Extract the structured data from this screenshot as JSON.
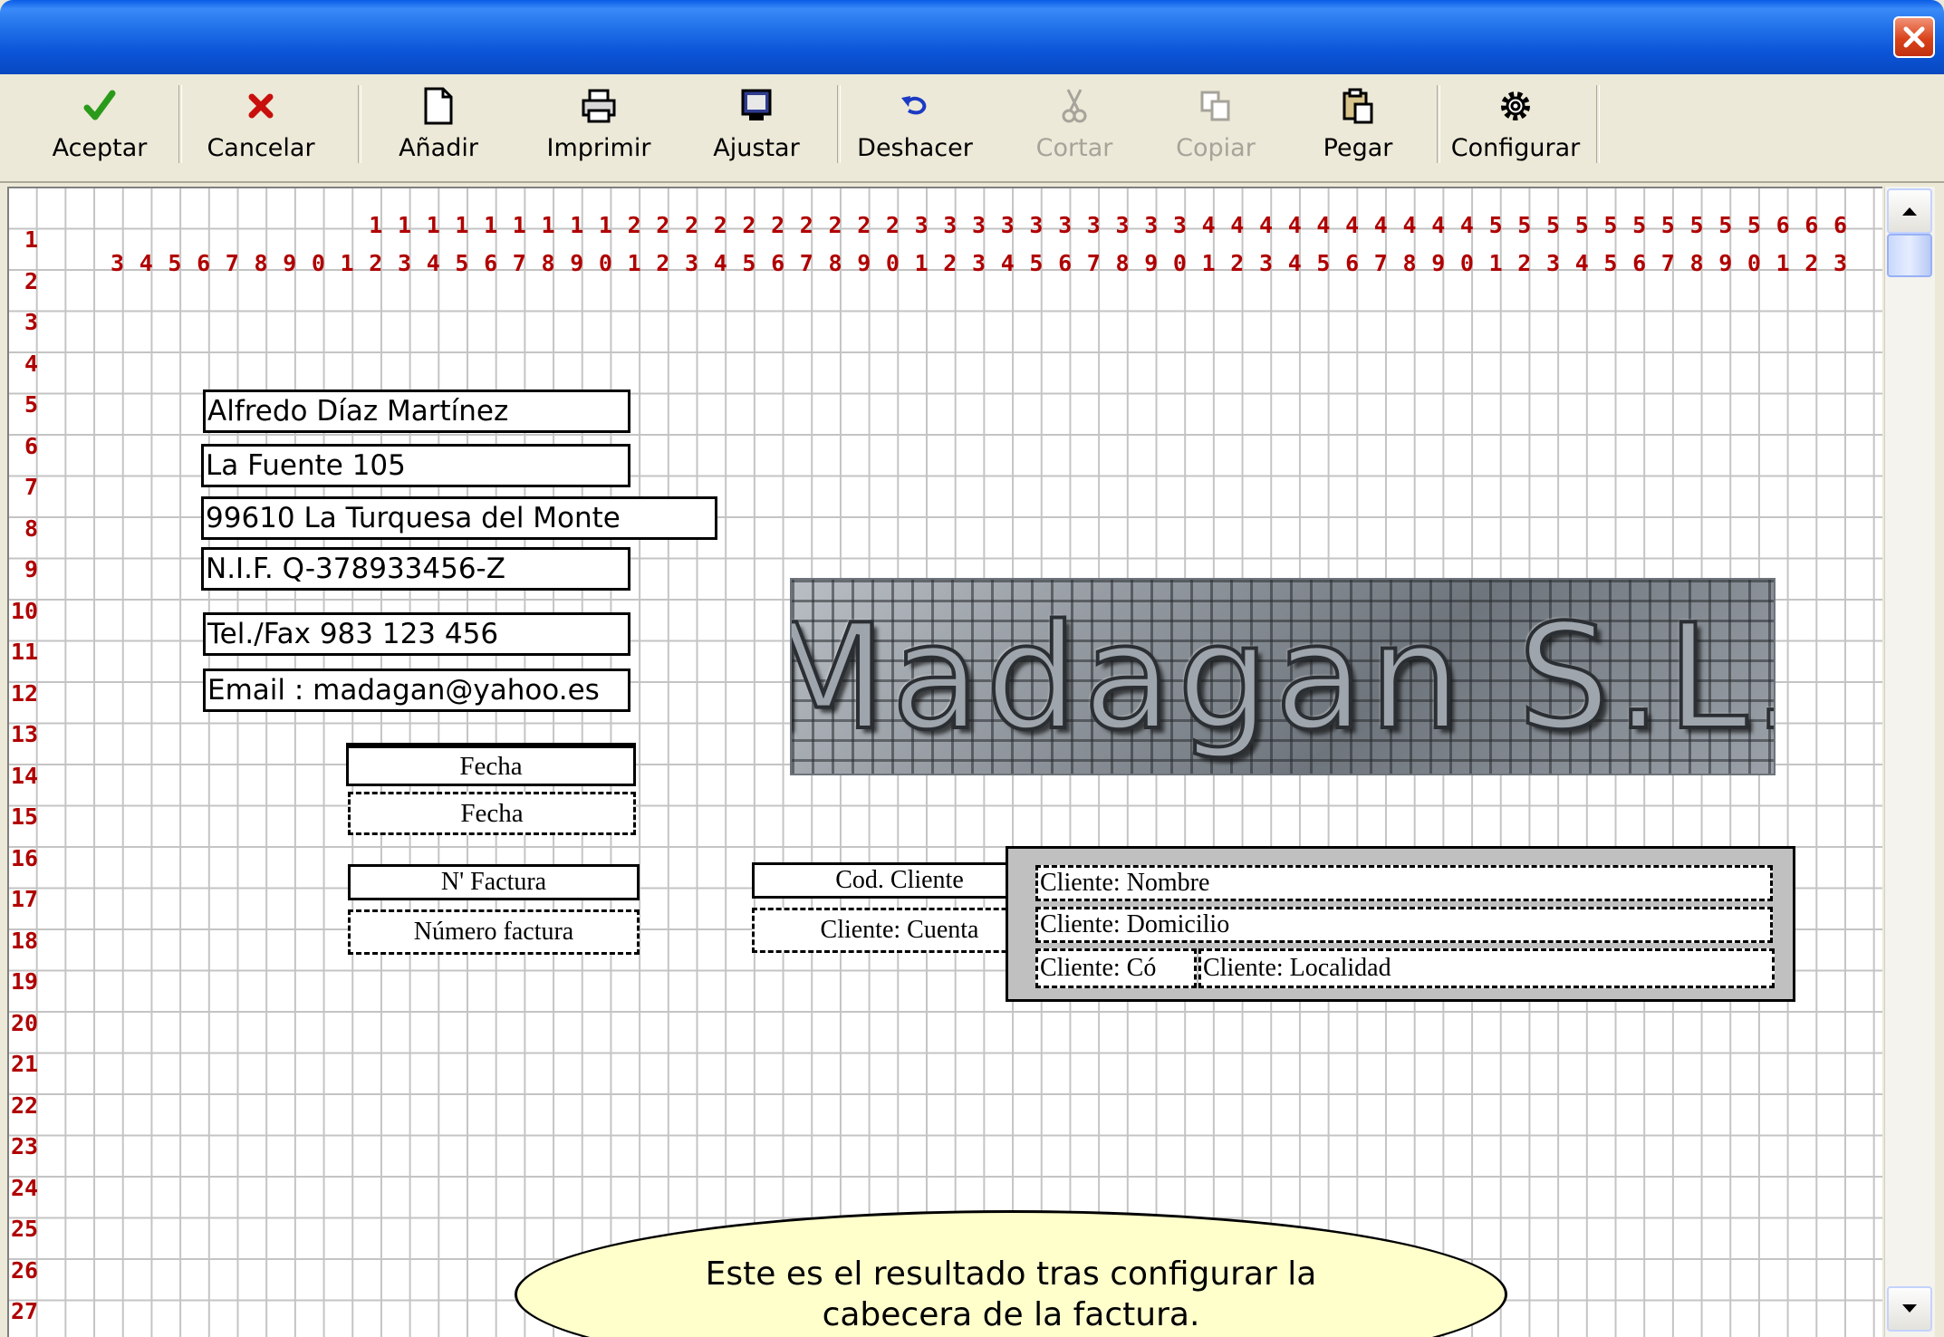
{
  "window": {
    "title": "",
    "close_icon": "close-icon"
  },
  "toolbar": {
    "items": [
      {
        "label": "Aceptar",
        "icon": "checkmark-icon",
        "enabled": true
      },
      {
        "label": "Cancelar",
        "icon": "x-icon",
        "enabled": true
      },
      {
        "label": "Añadir",
        "icon": "new-page-icon",
        "enabled": true
      },
      {
        "label": "Imprimir",
        "icon": "printer-icon",
        "enabled": true
      },
      {
        "label": "Ajustar",
        "icon": "monitor-icon",
        "enabled": true
      },
      {
        "label": "Deshacer",
        "icon": "undo-icon",
        "enabled": true
      },
      {
        "label": "Cortar",
        "icon": "scissors-icon",
        "enabled": false
      },
      {
        "label": "Copiar",
        "icon": "copy-icon",
        "enabled": false
      },
      {
        "label": "Pegar",
        "icon": "paste-icon",
        "enabled": true
      },
      {
        "label": "Configurar",
        "icon": "gear-icon",
        "enabled": true
      }
    ]
  },
  "ruler": {
    "tens": [
      "1",
      "1",
      "1",
      "1",
      "1",
      "1",
      "1",
      "1",
      "1",
      "2",
      "2",
      "2",
      "2",
      "2",
      "2",
      "2",
      "2",
      "2",
      "2",
      "3",
      "3",
      "3",
      "3",
      "3",
      "3",
      "3",
      "3",
      "3",
      "3",
      "4",
      "4",
      "4",
      "4",
      "4",
      "4",
      "4",
      "4",
      "4",
      "4",
      "5",
      "5",
      "5",
      "5",
      "5",
      "5",
      "5",
      "5",
      "5",
      "5",
      "6",
      "6",
      "6"
    ],
    "units": [
      "3",
      "4",
      "5",
      "6",
      "7",
      "8",
      "9",
      "0",
      "1",
      "2",
      "3",
      "4",
      "5",
      "6",
      "7",
      "8",
      "9",
      "0",
      "1",
      "2",
      "3",
      "4",
      "5",
      "6",
      "7",
      "8",
      "9",
      "0",
      "1",
      "2",
      "3",
      "4",
      "5",
      "6",
      "7",
      "8",
      "9",
      "0",
      "1",
      "2",
      "3",
      "4",
      "5",
      "6",
      "7",
      "8",
      "9",
      "0",
      "1",
      "2",
      "3",
      "4",
      "5",
      "6",
      "7",
      "8",
      "9",
      "0",
      "1",
      "2",
      "3"
    ],
    "rows": [
      "1",
      "2",
      "3",
      "4",
      "5",
      "6",
      "7",
      "8",
      "9",
      "10",
      "11",
      "12",
      "13",
      "14",
      "15",
      "16",
      "17",
      "18",
      "19",
      "20",
      "21",
      "22",
      "23",
      "24",
      "25",
      "26",
      "27"
    ]
  },
  "company": {
    "name": "Alfredo Díaz Martínez",
    "address": "La Fuente 105",
    "city": "99610 La Turquesa del Monte",
    "nif": "N.I.F. Q-378933456-Z",
    "phone": "Tel./Fax 983 123 456",
    "email": "Email : madagan@yahoo.es"
  },
  "logo": {
    "text": "Madagan S.L."
  },
  "invoice": {
    "date_label": "Fecha",
    "date_value": "Fecha",
    "number_label": "N' Factura",
    "number_value": "Número factura",
    "client_code_label": "Cod. Cliente",
    "client_code_value": "Cliente: Cuenta"
  },
  "client": {
    "name": "Cliente: Nombre",
    "address": "Cliente: Domicilio",
    "postal_code": "Cliente: Có",
    "city": "Cliente: Localidad"
  },
  "callout": {
    "line1": "Este es el resultado tras configurar la",
    "line2": "cabecera de la factura."
  },
  "scrollbar": {
    "up_icon": "arrow-up-icon",
    "down_icon": "arrow-down-icon"
  }
}
